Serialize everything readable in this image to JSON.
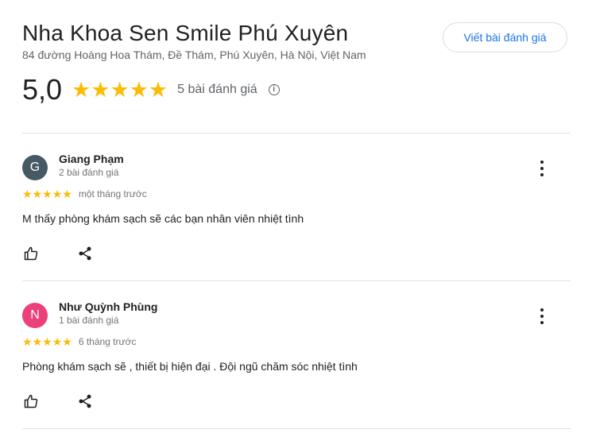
{
  "place": {
    "name": "Nha Khoa Sen Smile Phú Xuyên",
    "address": "84 đường Hoàng Hoa Thám, Đề Thám, Phú Xuyên, Hà Nội, Việt Nam"
  },
  "write_review_label": "Viết bài đánh giá",
  "summary": {
    "rating": "5,0",
    "stars": 5,
    "review_count_label": "5 bài đánh giá",
    "info_symbol": "i"
  },
  "colors": {
    "star": "#fbbc04",
    "accent": "#1a73e8"
  },
  "reviews": [
    {
      "initial": "G",
      "avatar_color": "#455a64",
      "name": "Giang Phạm",
      "meta": "2 bài đánh giá",
      "stars": 5,
      "time": "một tháng trước",
      "text": "M thấy phòng khám sạch sẽ các bạn nhân viên nhiệt tình"
    },
    {
      "initial": "N",
      "avatar_color": "#ec407a",
      "name": "Như Quỳnh Phùng",
      "meta": "1 bài đánh giá",
      "stars": 5,
      "time": "6 tháng trước",
      "text": "Phòng khám sạch sẽ , thiết bị hiện đại . Đội ngũ chăm sóc nhiệt tình"
    }
  ],
  "icons": {
    "star": "star-icon",
    "like": "thumb-up-icon",
    "share": "share-icon",
    "more": "more-vert-icon",
    "info": "info-icon"
  }
}
